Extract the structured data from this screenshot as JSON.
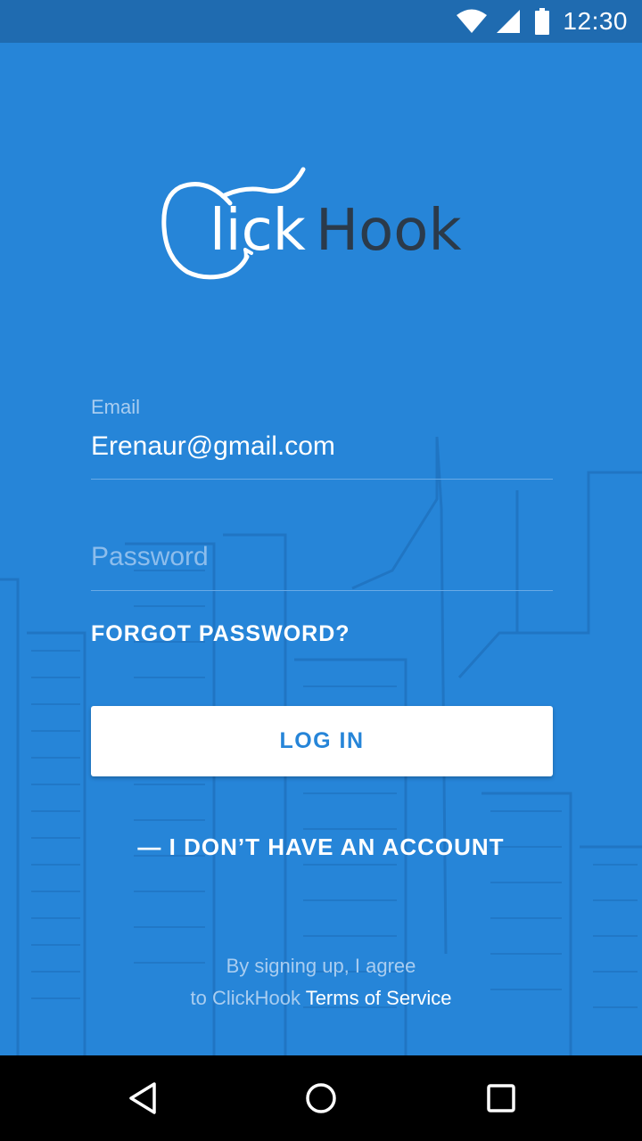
{
  "status_bar": {
    "time": "12:30",
    "icons": [
      "wifi-icon",
      "signal-icon",
      "battery-icon"
    ]
  },
  "logo": {
    "name": "ClickHook",
    "text_part_light": "lick",
    "text_part_dark": "Hook"
  },
  "form": {
    "email_label": "Email",
    "email_value": "Erenaur@gmail.com",
    "password_placeholder": "Password",
    "forgot_password": "FORGOT PASSWORD?",
    "login_button": "LOG IN",
    "no_account": "— I DON’T HAVE AN ACCOUNT"
  },
  "terms": {
    "line1": "By signing up, I agree",
    "line2_prefix": "to ClickHook",
    "line2_link": "Terms of Service"
  },
  "nav_bar": {
    "icons": [
      "back-icon",
      "home-icon",
      "recents-icon"
    ]
  },
  "colors": {
    "background": "#2685d8",
    "status_bar": "#1f6bb0",
    "logo_dark": "#2b3a4a",
    "button_text": "#2685d8",
    "label": "#a9cdf0"
  }
}
